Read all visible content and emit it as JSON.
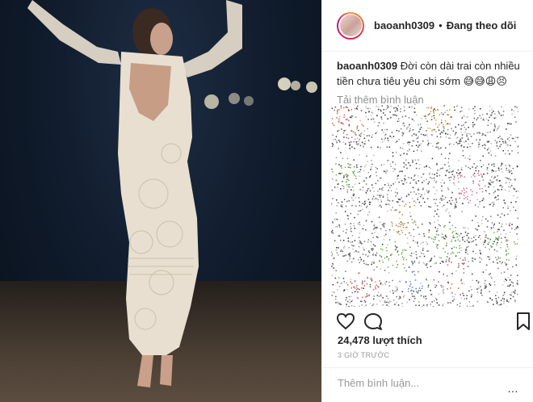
{
  "header": {
    "username": "baoanh0309",
    "separator": "•",
    "follow_status": "Đang theo dõi"
  },
  "caption": {
    "username": "baoanh0309",
    "text": "Đời còn dài trai còn nhiều tiền chưa tiêu yêu chi sớm 😅😅😩😣"
  },
  "comments": {
    "load_more": "Tải thêm bình luận"
  },
  "actions": {
    "like_icon": "heart-icon",
    "comment_icon": "comment-icon",
    "save_icon": "bookmark-icon"
  },
  "stats": {
    "likes": "24,478 lượt thích",
    "timestamp": "3 GIỜ TRƯỚC"
  },
  "comment_input": {
    "placeholder": "Thêm bình luận..."
  },
  "more_options": "…"
}
